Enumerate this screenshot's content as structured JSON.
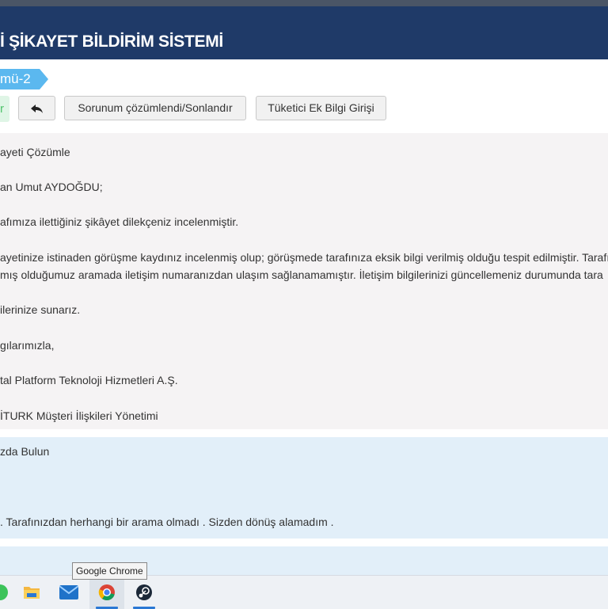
{
  "header": {
    "title": "İ ŞİKAYET BİLDİRİM SİSTEMİ"
  },
  "stage": {
    "label": "mü-2"
  },
  "toolbar": {
    "green_label": "r",
    "back_icon": "reply-arrow-icon",
    "solve_label": "Sorunum çözümlendi/Sonlandır",
    "extra_info_label": "Tüketici Ek Bilgi Girişi"
  },
  "message": {
    "lines": [
      "ayeti Çözümle",
      "an Umut AYDOĞDU;",
      "afımıza ilettiğiniz şikâyet dilekçeniz incelenmiştir.",
      "ayetinize istinaden görüşme kaydınız incelenmiş olup; görüşmede tarafınıza eksik bilgi verilmiş olduğu tespit edilmiştir. Tarafı",
      "mış olduğumuz aramada iletişim numaranızdan ulaşım sağlanamamıştır. İletişim bilgilerinizi güncellemeniz durumunda tara",
      "ilerinize sunarız.",
      "gılarımızla,",
      "tal Platform Teknoloji Hizmetleri A.Ş.",
      "İTURK Müşteri İlişkileri Yönetimi"
    ]
  },
  "reply": {
    "title": "zda Bulun",
    "text": ". Tarafınızdan herhangi bir arama olmadı . Sizden dönüş alamadım ."
  },
  "taskbar": {
    "tooltip": "Google Chrome",
    "apps": [
      "whatsapp-icon",
      "file-explorer-icon",
      "mail-icon",
      "chrome-icon",
      "steam-icon"
    ]
  }
}
